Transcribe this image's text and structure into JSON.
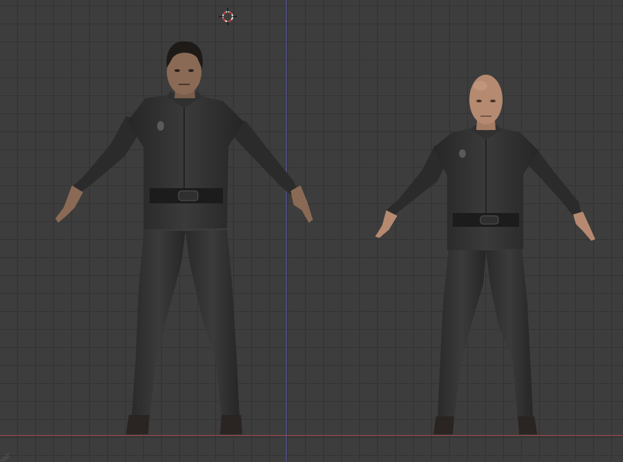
{
  "viewport": {
    "background": "#3d3d3d",
    "grid_color": "#333333",
    "axis_y_color": "#5a5ab2",
    "axis_x_color": "#b04848",
    "cursor_icon": "3d-cursor-icon"
  },
  "models": [
    {
      "name": "male-character",
      "skin": "#8a6a55",
      "hair": "#1e1a18",
      "clothing": "#2c2c2c"
    },
    {
      "name": "bald-character",
      "skin": "#b58a70",
      "hair": "none",
      "clothing": "#2e2e2e"
    }
  ]
}
